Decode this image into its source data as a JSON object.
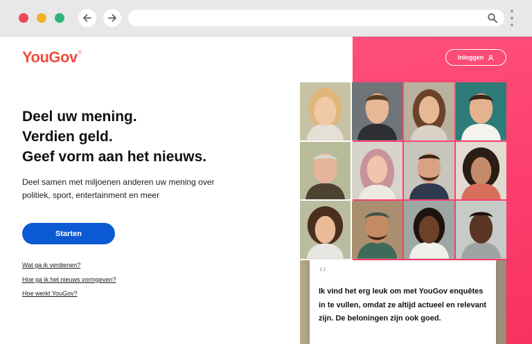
{
  "browser": {
    "controls": [
      "close",
      "minimize",
      "maximize"
    ],
    "nav_icons": [
      "arrow-left-icon",
      "arrow-right-icon"
    ],
    "address_icon": "search-icon",
    "menu_icon": "kebab-menu-icon"
  },
  "brand": {
    "name": "YouGov",
    "mark": "®",
    "color": "#f04c3e"
  },
  "header": {
    "login_label": "Inloggen",
    "login_icon": "user-icon"
  },
  "hero": {
    "headline": [
      "Deel uw mening.",
      "Verdien geld.",
      "Geef vorm aan het nieuws."
    ],
    "subtitle": "Deel samen met miljoenen anderen uw mening over politiek, sport, entertainment en meer",
    "cta_label": "Starten",
    "cta_color": "#0b5ad4"
  },
  "faq_links": [
    "Wat ga ik verdienen?",
    "Hoe ga ik het nieuws vormgeven?",
    "Hoe werkt YouGov?"
  ],
  "testimonial": {
    "quote_mark": "“",
    "text": "Ik vind het erg leuk om met YouGov enquêtes in te vullen, omdat ze altijd actueel en relevant zijn. De beloningen zijn ook goed."
  },
  "colors": {
    "accent_pink": "#fc3d6c",
    "cta_blue": "#0b5ad4"
  }
}
